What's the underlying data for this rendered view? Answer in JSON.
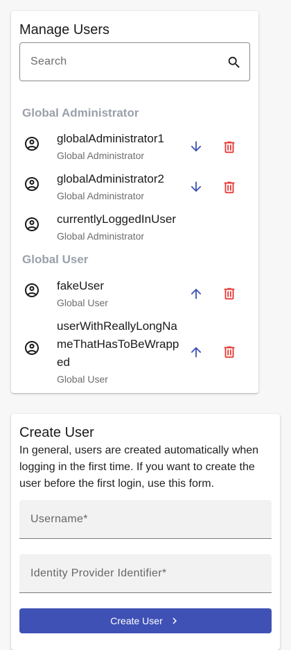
{
  "manage": {
    "title": "Manage Users",
    "search_placeholder": "Search",
    "groups": [
      {
        "label": "Global Administrator",
        "users": [
          {
            "name": "globalAdministrator1",
            "role": "Global Administrator",
            "action": "demote"
          },
          {
            "name": "globalAdministrator2",
            "role": "Global Administrator",
            "action": "demote"
          },
          {
            "name": "currentlyLoggedInUser",
            "role": "Global Administrator",
            "action": "none"
          }
        ]
      },
      {
        "label": "Global User",
        "users": [
          {
            "name": "fakeUser",
            "role": "Global User",
            "action": "promote"
          },
          {
            "name": "userWithReallyLongNameThatHasToBeWrapped",
            "role": "Global User",
            "action": "promote"
          }
        ]
      }
    ]
  },
  "create": {
    "title": "Create User",
    "description": "In general, users are created automatically when logging in the first time. If you want to create the user before the first login, use this form.",
    "username_placeholder": "Username*",
    "idp_placeholder": "Identity Provider Identifier*",
    "button_label": "Create User"
  },
  "colors": {
    "primary": "#3f51b5",
    "delete": "#e53935",
    "group_header": "#9aa0ab"
  },
  "icons": {
    "search": "search-icon",
    "avatar": "account-circle-icon",
    "promote": "arrow-up-icon",
    "demote": "arrow-down-icon",
    "delete": "trash-icon",
    "button": "chevron-right-icon"
  }
}
